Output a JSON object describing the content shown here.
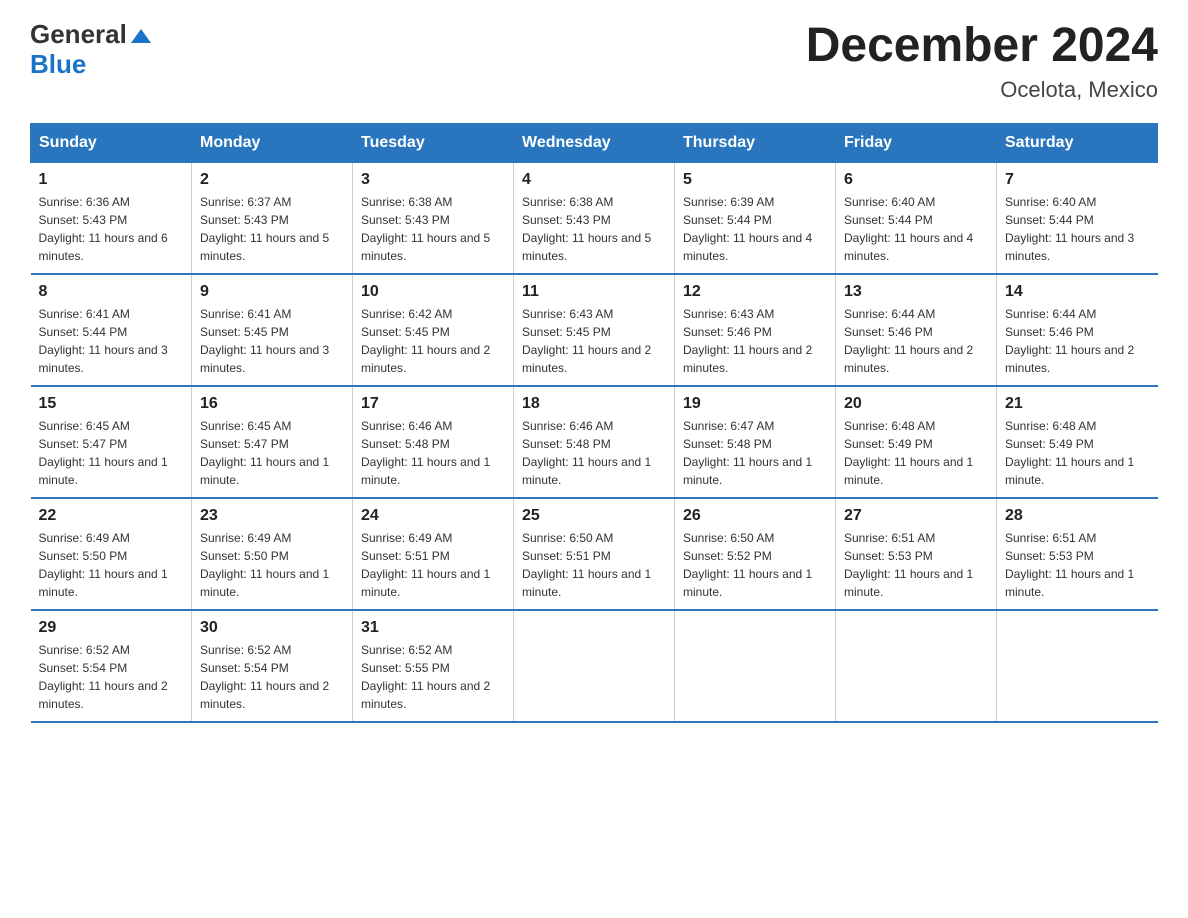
{
  "logo": {
    "text_general": "General",
    "text_blue": "Blue"
  },
  "header": {
    "month_year": "December 2024",
    "location": "Ocelota, Mexico"
  },
  "weekdays": [
    "Sunday",
    "Monday",
    "Tuesday",
    "Wednesday",
    "Thursday",
    "Friday",
    "Saturday"
  ],
  "weeks": [
    [
      {
        "day": "1",
        "sunrise": "6:36 AM",
        "sunset": "5:43 PM",
        "daylight": "11 hours and 6 minutes."
      },
      {
        "day": "2",
        "sunrise": "6:37 AM",
        "sunset": "5:43 PM",
        "daylight": "11 hours and 5 minutes."
      },
      {
        "day": "3",
        "sunrise": "6:38 AM",
        "sunset": "5:43 PM",
        "daylight": "11 hours and 5 minutes."
      },
      {
        "day": "4",
        "sunrise": "6:38 AM",
        "sunset": "5:43 PM",
        "daylight": "11 hours and 5 minutes."
      },
      {
        "day": "5",
        "sunrise": "6:39 AM",
        "sunset": "5:44 PM",
        "daylight": "11 hours and 4 minutes."
      },
      {
        "day": "6",
        "sunrise": "6:40 AM",
        "sunset": "5:44 PM",
        "daylight": "11 hours and 4 minutes."
      },
      {
        "day": "7",
        "sunrise": "6:40 AM",
        "sunset": "5:44 PM",
        "daylight": "11 hours and 3 minutes."
      }
    ],
    [
      {
        "day": "8",
        "sunrise": "6:41 AM",
        "sunset": "5:44 PM",
        "daylight": "11 hours and 3 minutes."
      },
      {
        "day": "9",
        "sunrise": "6:41 AM",
        "sunset": "5:45 PM",
        "daylight": "11 hours and 3 minutes."
      },
      {
        "day": "10",
        "sunrise": "6:42 AM",
        "sunset": "5:45 PM",
        "daylight": "11 hours and 2 minutes."
      },
      {
        "day": "11",
        "sunrise": "6:43 AM",
        "sunset": "5:45 PM",
        "daylight": "11 hours and 2 minutes."
      },
      {
        "day": "12",
        "sunrise": "6:43 AM",
        "sunset": "5:46 PM",
        "daylight": "11 hours and 2 minutes."
      },
      {
        "day": "13",
        "sunrise": "6:44 AM",
        "sunset": "5:46 PM",
        "daylight": "11 hours and 2 minutes."
      },
      {
        "day": "14",
        "sunrise": "6:44 AM",
        "sunset": "5:46 PM",
        "daylight": "11 hours and 2 minutes."
      }
    ],
    [
      {
        "day": "15",
        "sunrise": "6:45 AM",
        "sunset": "5:47 PM",
        "daylight": "11 hours and 1 minute."
      },
      {
        "day": "16",
        "sunrise": "6:45 AM",
        "sunset": "5:47 PM",
        "daylight": "11 hours and 1 minute."
      },
      {
        "day": "17",
        "sunrise": "6:46 AM",
        "sunset": "5:48 PM",
        "daylight": "11 hours and 1 minute."
      },
      {
        "day": "18",
        "sunrise": "6:46 AM",
        "sunset": "5:48 PM",
        "daylight": "11 hours and 1 minute."
      },
      {
        "day": "19",
        "sunrise": "6:47 AM",
        "sunset": "5:48 PM",
        "daylight": "11 hours and 1 minute."
      },
      {
        "day": "20",
        "sunrise": "6:48 AM",
        "sunset": "5:49 PM",
        "daylight": "11 hours and 1 minute."
      },
      {
        "day": "21",
        "sunrise": "6:48 AM",
        "sunset": "5:49 PM",
        "daylight": "11 hours and 1 minute."
      }
    ],
    [
      {
        "day": "22",
        "sunrise": "6:49 AM",
        "sunset": "5:50 PM",
        "daylight": "11 hours and 1 minute."
      },
      {
        "day": "23",
        "sunrise": "6:49 AM",
        "sunset": "5:50 PM",
        "daylight": "11 hours and 1 minute."
      },
      {
        "day": "24",
        "sunrise": "6:49 AM",
        "sunset": "5:51 PM",
        "daylight": "11 hours and 1 minute."
      },
      {
        "day": "25",
        "sunrise": "6:50 AM",
        "sunset": "5:51 PM",
        "daylight": "11 hours and 1 minute."
      },
      {
        "day": "26",
        "sunrise": "6:50 AM",
        "sunset": "5:52 PM",
        "daylight": "11 hours and 1 minute."
      },
      {
        "day": "27",
        "sunrise": "6:51 AM",
        "sunset": "5:53 PM",
        "daylight": "11 hours and 1 minute."
      },
      {
        "day": "28",
        "sunrise": "6:51 AM",
        "sunset": "5:53 PM",
        "daylight": "11 hours and 1 minute."
      }
    ],
    [
      {
        "day": "29",
        "sunrise": "6:52 AM",
        "sunset": "5:54 PM",
        "daylight": "11 hours and 2 minutes."
      },
      {
        "day": "30",
        "sunrise": "6:52 AM",
        "sunset": "5:54 PM",
        "daylight": "11 hours and 2 minutes."
      },
      {
        "day": "31",
        "sunrise": "6:52 AM",
        "sunset": "5:55 PM",
        "daylight": "11 hours and 2 minutes."
      },
      null,
      null,
      null,
      null
    ]
  ],
  "colors": {
    "header_bg": "#2a76be",
    "accent": "#1a73c8"
  }
}
